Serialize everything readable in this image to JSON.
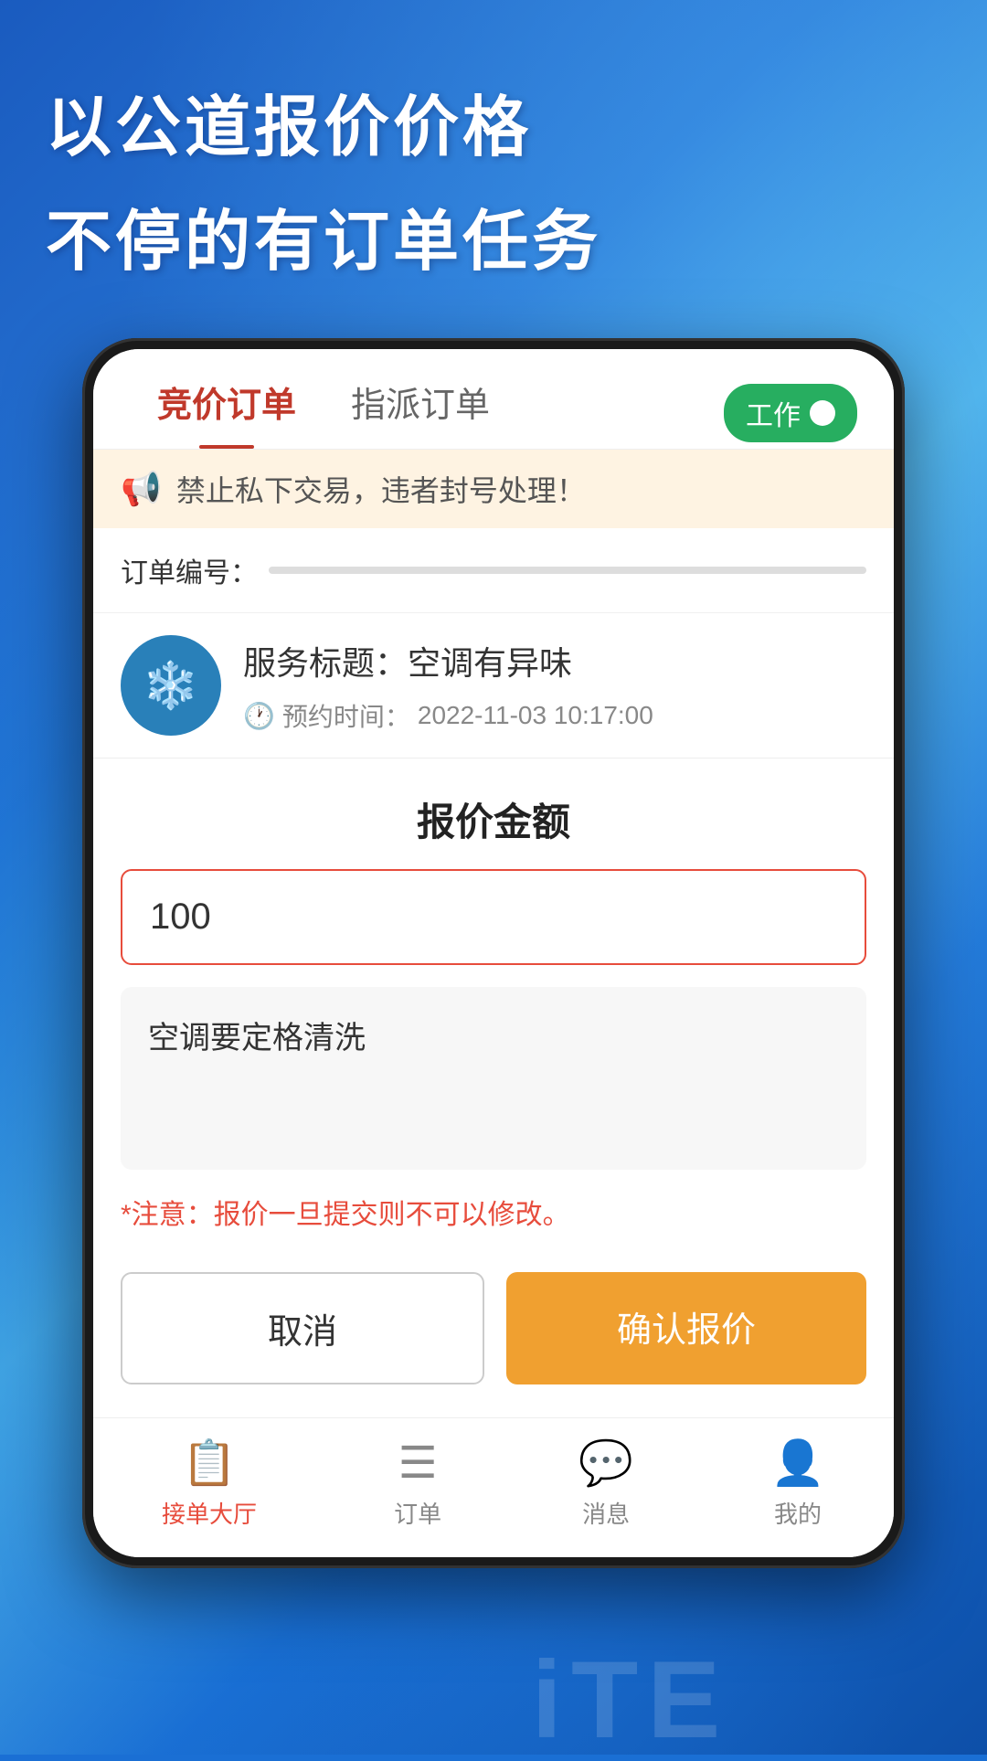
{
  "background": {
    "colors": [
      "#1a5bbf",
      "#2979d8",
      "#4db0e8"
    ]
  },
  "header": {
    "line1": "以公道报价价格",
    "line2": "不停的有订单任务"
  },
  "tabs": {
    "tab1": "竞价订单",
    "tab2": "指派订单",
    "toggle_label": "工作"
  },
  "notice": {
    "text": "禁止私下交易，违者封号处理！"
  },
  "order": {
    "label": "订单编号："
  },
  "service": {
    "title": "服务标题：空调有异味",
    "time_label": "预约时间：",
    "time_value": "2022-11-03 10:17:00"
  },
  "modal": {
    "title": "报价金额",
    "price_value": "100",
    "remark_text": "空调要定格清洗",
    "warning": "*注意：报价一旦提交则不可以修改。",
    "cancel_btn": "取消",
    "confirm_btn": "确认报价"
  },
  "bottom_nav": {
    "items": [
      {
        "label": "接单大厅",
        "active": true
      },
      {
        "label": "订单",
        "active": false
      },
      {
        "label": "消息",
        "active": false
      },
      {
        "label": "我的",
        "active": false
      }
    ]
  },
  "watermark": "iTE"
}
